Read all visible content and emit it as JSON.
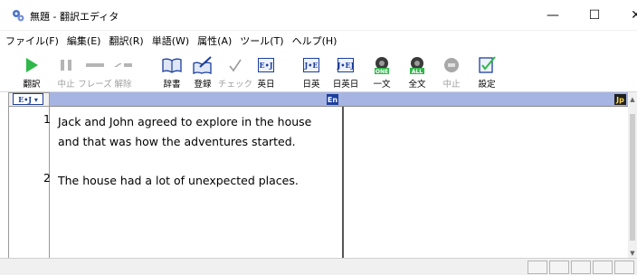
{
  "window": {
    "title": "無題 - 翻訳エディタ",
    "minimize": "—",
    "maximize": "☐",
    "close": "✕"
  },
  "menu": [
    {
      "label": "ファイル(F)"
    },
    {
      "label": "編集(E)"
    },
    {
      "label": "翻訳(R)"
    },
    {
      "label": "単語(W)"
    },
    {
      "label": "属性(A)"
    },
    {
      "label": "ツール(T)"
    },
    {
      "label": "ヘルプ(H)"
    }
  ],
  "toolbar": {
    "translate": "翻訳",
    "stop": "中止",
    "phrase": "フレーズ",
    "release": "解除",
    "dictionary": "辞書",
    "register": "登録",
    "check": "チェック",
    "en_ja": "英日",
    "ja_en": "日英",
    "ja_en_ja": "日英日",
    "one_sentence": "一文",
    "all_sentences": "全文",
    "stop2": "中止",
    "settings": "設定",
    "icon_en_ja": "E•J",
    "icon_ja_en": "J•E",
    "icon_ja_en_ja": "J•EJ",
    "icon_one": "ONE",
    "icon_all": "ALL"
  },
  "panes": {
    "direction_dropdown": "E•J ▾",
    "source_badge": "En",
    "target_badge": "Jp"
  },
  "sentences": [
    {
      "number": "1",
      "lines": [
        "Jack and John agreed to explore in the house",
        "and that was how the adventures started."
      ]
    },
    {
      "number": "2",
      "lines": [
        "The house had a lot of unexpected places."
      ]
    }
  ],
  "colors": {
    "pane_header": "#a6b4e2",
    "accent_blue": "#1d3f9c",
    "play_green": "#2fb84a"
  },
  "icons": {
    "app": "app-gears-icon",
    "translate": "play-icon",
    "stop": "pause-icon",
    "dictionary": "book-icon",
    "register": "pencil-book-icon",
    "check": "checkmark-icon",
    "settings": "settings-check-icon"
  }
}
